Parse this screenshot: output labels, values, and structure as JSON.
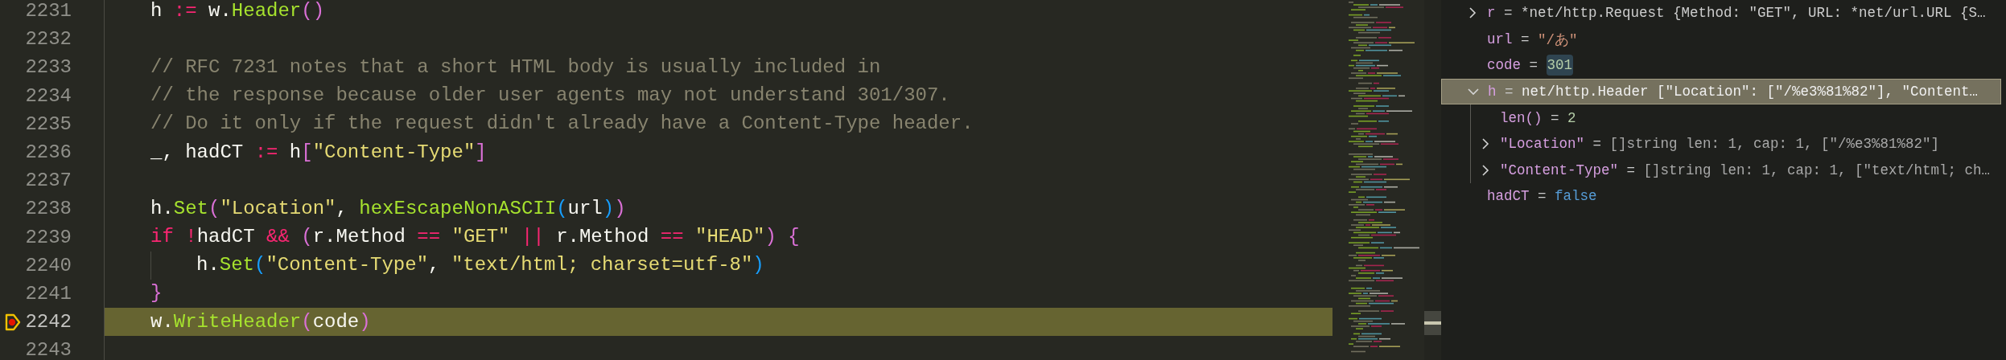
{
  "editor": {
    "lines": [
      {
        "number": "2231",
        "current": false,
        "indented": false,
        "tokens": [
          {
            "text": "h ",
            "kind": "plain"
          },
          {
            "text": ":=",
            "kind": "keyword"
          },
          {
            "text": " w.",
            "kind": "plain"
          },
          {
            "text": "Header",
            "kind": "func"
          },
          {
            "text": "()",
            "kind": "bracket-a"
          }
        ]
      },
      {
        "number": "2232",
        "current": false
      },
      {
        "number": "2233",
        "current": false,
        "indented": false,
        "tokens": [
          {
            "text": "// RFC 7231 notes that a short HTML body is usually included in",
            "kind": "comment"
          }
        ]
      },
      {
        "number": "2234",
        "current": false,
        "indented": false,
        "tokens": [
          {
            "text": "// the response because older user agents may not understand 301/307.",
            "kind": "comment"
          }
        ]
      },
      {
        "number": "2235",
        "current": false,
        "indented": false,
        "tokens": [
          {
            "text": "// Do it only if the request didn't already have a Content-Type header.",
            "kind": "comment"
          }
        ]
      },
      {
        "number": "2236",
        "current": false,
        "indented": false,
        "tokens": [
          {
            "text": "_, hadCT ",
            "kind": "plain"
          },
          {
            "text": ":=",
            "kind": "keyword"
          },
          {
            "text": " h",
            "kind": "plain"
          },
          {
            "text": "[",
            "kind": "bracket-a"
          },
          {
            "text": "\"Content-Type\"",
            "kind": "string"
          },
          {
            "text": "]",
            "kind": "bracket-a"
          }
        ]
      },
      {
        "number": "2237",
        "current": false
      },
      {
        "number": "2238",
        "current": false,
        "indented": false,
        "tokens": [
          {
            "text": "h.",
            "kind": "plain"
          },
          {
            "text": "Set",
            "kind": "func"
          },
          {
            "text": "(",
            "kind": "bracket-a"
          },
          {
            "text": "\"Location\"",
            "kind": "string"
          },
          {
            "text": ", ",
            "kind": "plain"
          },
          {
            "text": "hexEscapeNonASCII",
            "kind": "func"
          },
          {
            "text": "(",
            "kind": "bracket-b"
          },
          {
            "text": "url",
            "kind": "plain"
          },
          {
            "text": ")",
            "kind": "bracket-b"
          },
          {
            "text": ")",
            "kind": "bracket-a"
          }
        ]
      },
      {
        "number": "2239",
        "current": false,
        "indented": false,
        "tokens": [
          {
            "text": "if",
            "kind": "keyword"
          },
          {
            "text": " !",
            "kind": "keyword"
          },
          {
            "text": "hadCT ",
            "kind": "plain"
          },
          {
            "text": "&&",
            "kind": "keyword"
          },
          {
            "text": " (",
            "kind": "bracket-a"
          },
          {
            "text": "r.Method ",
            "kind": "plain"
          },
          {
            "text": "==",
            "kind": "keyword"
          },
          {
            "text": " \"GET\"",
            "kind": "string"
          },
          {
            "text": " ||",
            "kind": "keyword"
          },
          {
            "text": " r.Method ",
            "kind": "plain"
          },
          {
            "text": "==",
            "kind": "keyword"
          },
          {
            "text": " \"HEAD\"",
            "kind": "string"
          },
          {
            "text": ")",
            "kind": "bracket-a"
          },
          {
            "text": " {",
            "kind": "bracket-a"
          }
        ]
      },
      {
        "number": "2240",
        "current": false,
        "indented": true,
        "tokens": [
          {
            "text": "h.",
            "kind": "plain"
          },
          {
            "text": "Set",
            "kind": "func"
          },
          {
            "text": "(",
            "kind": "bracket-b"
          },
          {
            "text": "\"Content-Type\"",
            "kind": "string"
          },
          {
            "text": ", ",
            "kind": "plain"
          },
          {
            "text": "\"text/html; charset=utf-8\"",
            "kind": "string"
          },
          {
            "text": ")",
            "kind": "bracket-b"
          }
        ]
      },
      {
        "number": "2241",
        "current": false,
        "indented": false,
        "tokens": [
          {
            "text": "}",
            "kind": "bracket-a"
          }
        ]
      },
      {
        "number": "2242",
        "current": true,
        "indented": false,
        "tokens": [
          {
            "text": "w.",
            "kind": "plain"
          },
          {
            "text": "WriteHeader",
            "kind": "func"
          },
          {
            "text": "(",
            "kind": "bracket-a"
          },
          {
            "text": "code",
            "kind": "plain"
          },
          {
            "text": ")",
            "kind": "bracket-a"
          }
        ]
      },
      {
        "number": "2243",
        "current": false
      }
    ]
  },
  "variables": [
    {
      "name": "r",
      "operator": "=",
      "value": "*net/http.Request {Method: \"GET\", URL: *net/url.URL {S…",
      "kind": "object",
      "expandable": true,
      "expanded": false,
      "selected": false,
      "value_highlighted": false
    },
    {
      "name": "url",
      "operator": "=",
      "value": "\"/あ\"",
      "kind": "string",
      "expandable": false,
      "selected": false,
      "value_highlighted": false
    },
    {
      "name": "code",
      "operator": "=",
      "value": "301",
      "kind": "number",
      "expandable": false,
      "selected": false,
      "value_highlighted": true
    },
    {
      "name": "h",
      "operator": "=",
      "value": "net/http.Header [\"Location\": [\"/%e3%81%82\"], \"Content…",
      "kind": "object",
      "expandable": true,
      "expanded": true,
      "selected": true,
      "value_highlighted": false,
      "children": [
        {
          "name": "len()",
          "operator": "=",
          "value": "2",
          "kind": "number",
          "expandable": false,
          "selected": false,
          "value_highlighted": false
        },
        {
          "name": "\"Location\"",
          "operator": "=",
          "value": "[]string len: 1, cap: 1, [\"/%e3%81%82\"]",
          "kind": "collection",
          "expandable": true,
          "expanded": false,
          "selected": false,
          "value_highlighted": false
        },
        {
          "name": "\"Content-Type\"",
          "operator": "=",
          "value": "[]string len: 1, cap: 1, [\"text/html; ch…",
          "kind": "collection",
          "expandable": true,
          "expanded": false,
          "selected": false,
          "value_highlighted": false
        }
      ]
    },
    {
      "name": "hadCT",
      "operator": "=",
      "value": "false",
      "kind": "boolean",
      "expandable": false,
      "selected": false,
      "value_highlighted": false
    }
  ]
}
